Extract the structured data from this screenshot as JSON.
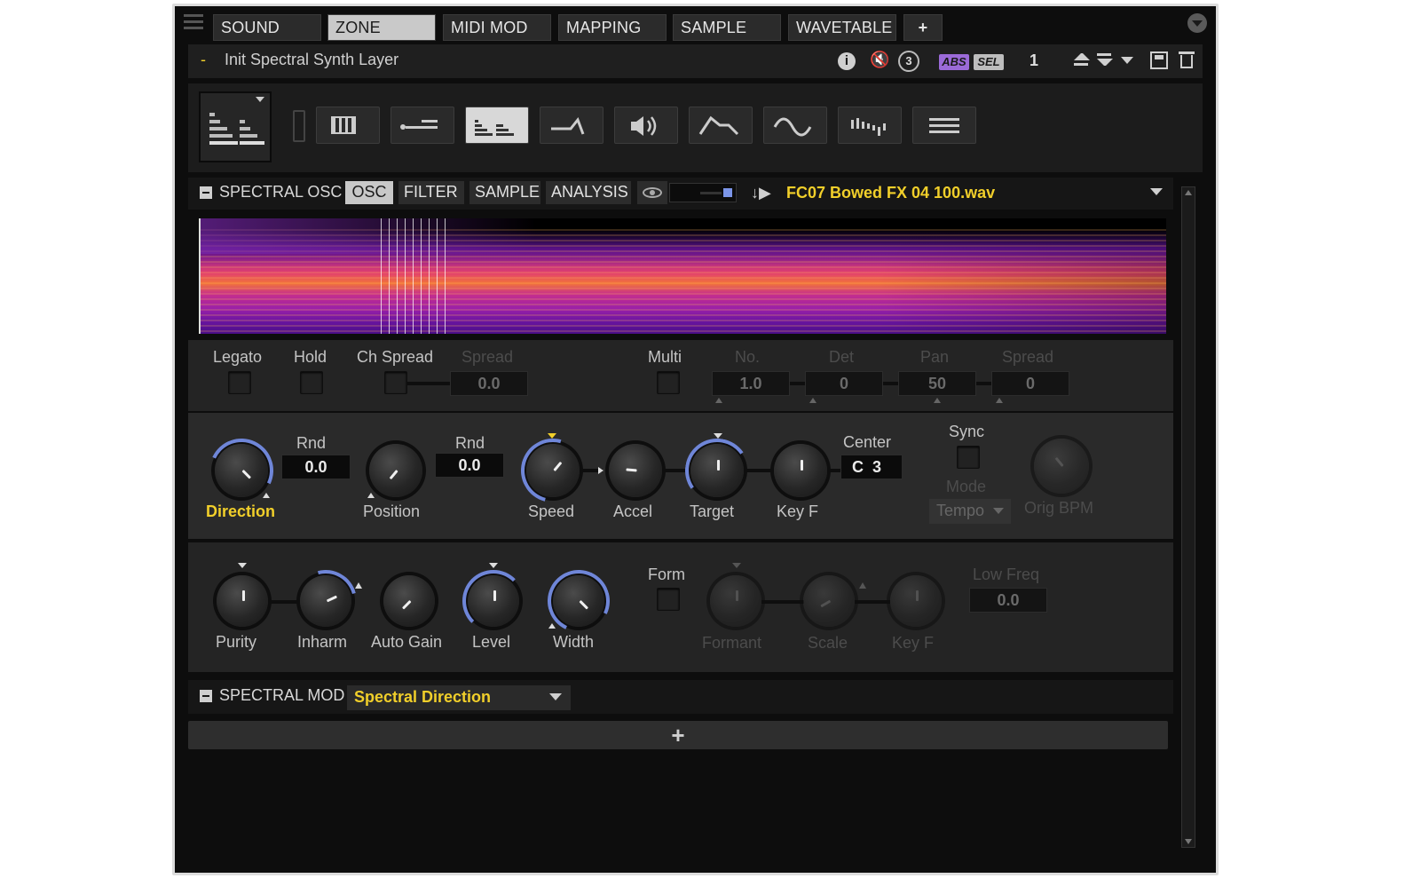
{
  "tabs": [
    {
      "label": "SOUND",
      "active": false
    },
    {
      "label": "ZONE",
      "active": true
    },
    {
      "label": "MIDI MOD",
      "active": false
    },
    {
      "label": "MAPPING",
      "active": false
    },
    {
      "label": "SAMPLE",
      "active": false
    },
    {
      "label": "WAVETABLE",
      "active": false
    }
  ],
  "tab_add": "+",
  "header": {
    "dash": "-",
    "title": "Init Spectral Synth Layer",
    "abs": "ABS",
    "sel": "SEL",
    "count": "1"
  },
  "spectral_osc": {
    "title": "SPECTRAL OSC",
    "subtabs": [
      "OSC",
      "FILTER",
      "SAMPLE",
      "ANALYSIS"
    ],
    "filename": "FC07 Bowed FX 04 100.wav"
  },
  "voice": {
    "legato": "Legato",
    "hold": "Hold",
    "ch_spread": "Ch Spread",
    "spread": "Spread",
    "spread_value": "0.0",
    "multi": "Multi",
    "no": "No.",
    "no_value": "1.0",
    "det": "Det",
    "det_value": "0",
    "pan": "Pan",
    "pan_value": "50",
    "spread2": "Spread",
    "spread2_value": "0"
  },
  "play": {
    "direction": "Direction",
    "rnd1": "Rnd",
    "rnd1_value": "0.0",
    "position": "Position",
    "rnd2": "Rnd",
    "rnd2_value": "0.0",
    "speed": "Speed",
    "accel": "Accel",
    "target": "Target",
    "keyf": "Key F",
    "center": "Center",
    "center_value": "C  3",
    "sync": "Sync",
    "mode": "Mode",
    "mode_value": "Tempo",
    "orig_bpm": "Orig BPM"
  },
  "shape": {
    "purity": "Purity",
    "inharm": "Inharm",
    "auto_gain": "Auto Gain",
    "level": "Level",
    "width": "Width",
    "form": "Form",
    "formant": "Formant",
    "scale": "Scale",
    "keyf": "Key F",
    "low_freq": "Low Freq",
    "low_freq_value": "0.0"
  },
  "spectral_mod": {
    "title": "SPECTRAL MOD",
    "preset": "Spectral Direction",
    "add": "+"
  },
  "colors": {
    "accent_yellow": "#f1cf2a",
    "knob_ring_blue": "#6f86d8",
    "abs_purple": "#9b6ad8"
  }
}
